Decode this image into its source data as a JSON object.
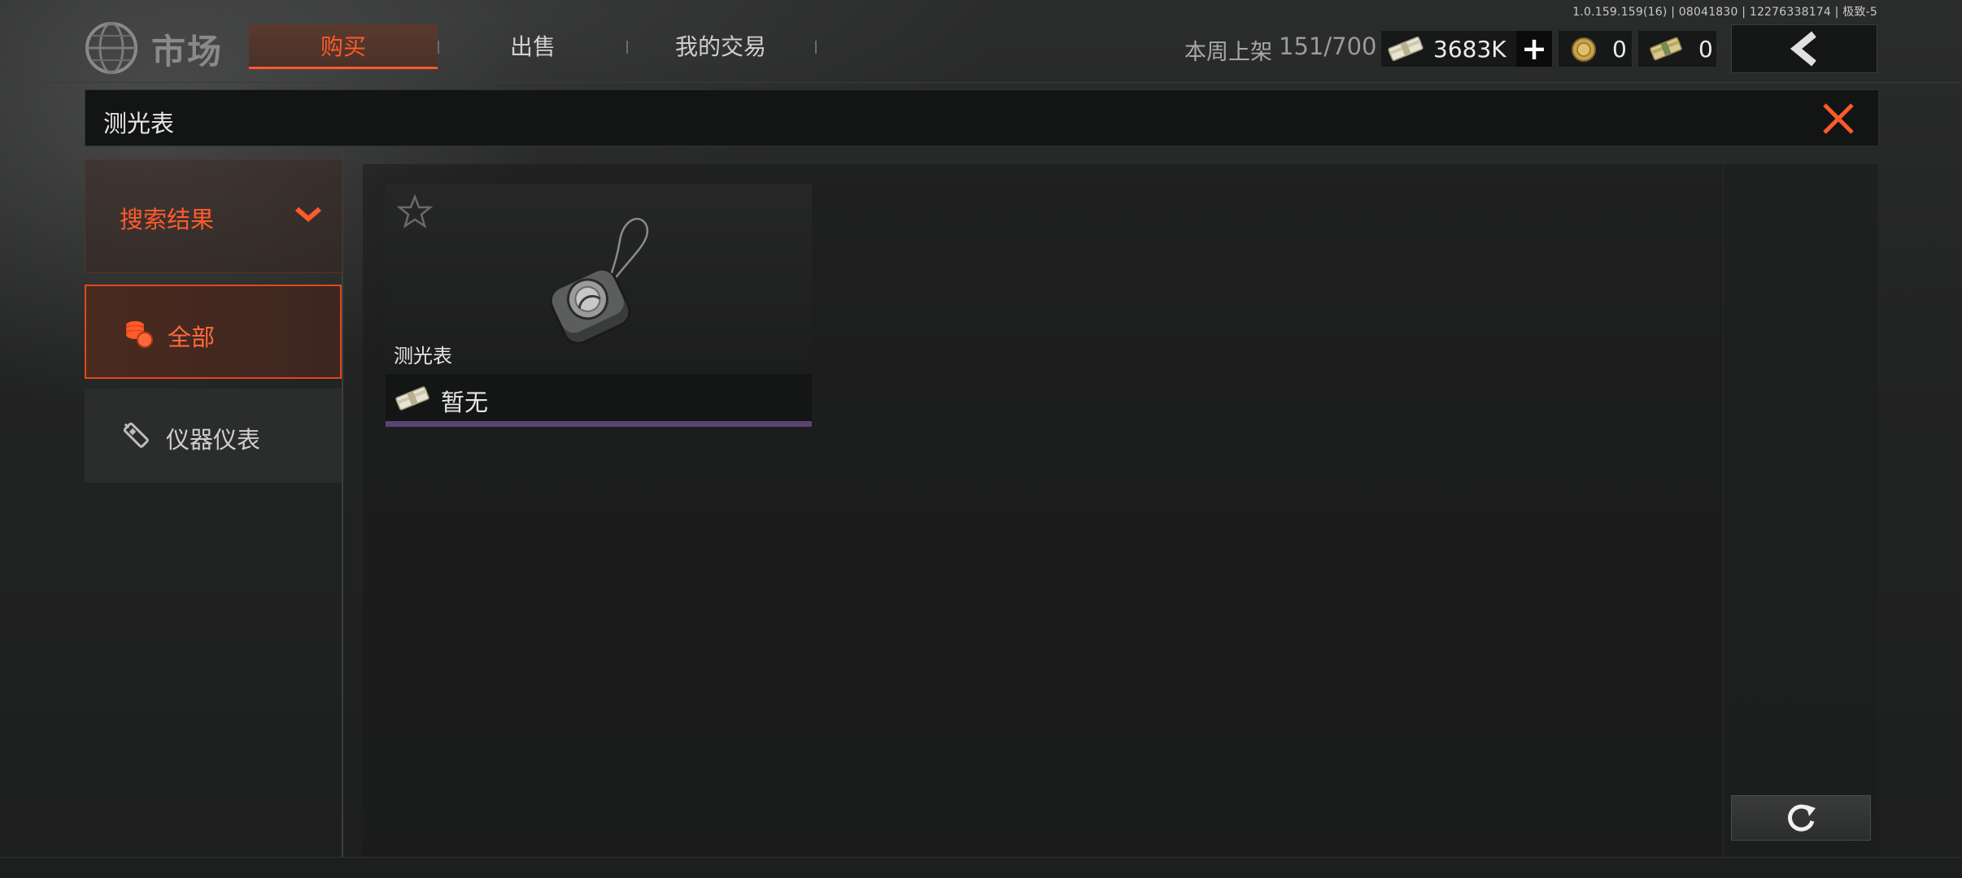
{
  "version": "1.0.159.159(16) | 08041830 | 12276338174 | 极致-5",
  "header": {
    "title": "市场",
    "tabs": [
      {
        "label": "购买",
        "active": true
      },
      {
        "label": "出售",
        "active": false
      },
      {
        "label": "我的交易",
        "active": false
      }
    ],
    "weekly_listing_label": "本周上架",
    "weekly_listing_count": "151/700",
    "currencies": {
      "cash": "3683K",
      "coins": "0",
      "bonds": "0"
    },
    "icons": {
      "logo": "globe-icon",
      "cash": "cash-bundle-icon",
      "add": "plus-icon",
      "coin": "gold-coin-icon",
      "bond": "bond-bundle-icon",
      "back": "chevron-left-icon"
    }
  },
  "search": {
    "query": "测光表",
    "close_icon": "close-icon"
  },
  "sidebar": {
    "header_label": "搜索结果",
    "items": [
      {
        "label": "全部",
        "icon": "coin-stack-icon",
        "active": true
      },
      {
        "label": "仪器仪表",
        "icon": "instrument-icon",
        "active": false
      }
    ]
  },
  "results": [
    {
      "name": "测光表",
      "price": "暂无",
      "favorite": false,
      "rarity_color": "#5a4476",
      "icon": "light-meter-icon"
    }
  ],
  "colors": {
    "accent": "#ff5a2a",
    "background": "#1f2020"
  },
  "refresh_icon": "refresh-icon"
}
